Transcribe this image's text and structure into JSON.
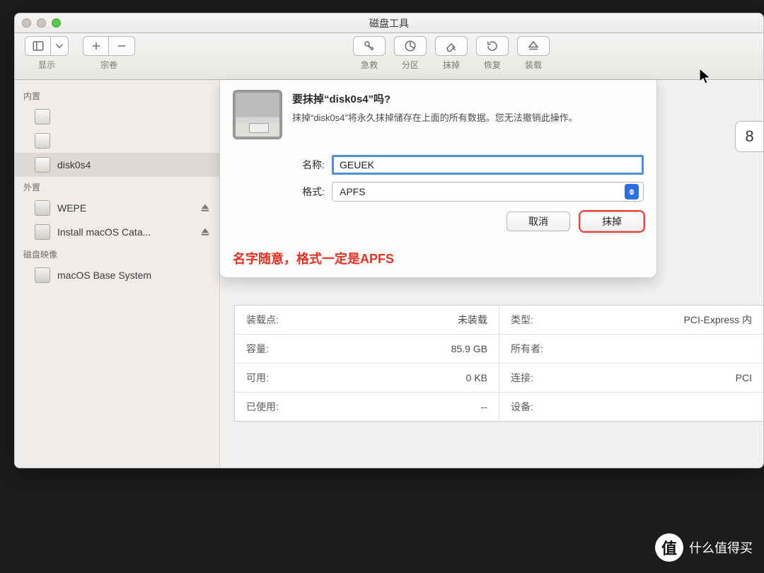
{
  "window": {
    "title": "磁盘工具"
  },
  "toolbar": {
    "view_label": "显示",
    "volume_label": "宗卷",
    "center": [
      {
        "name": "firstaid",
        "label": "急救"
      },
      {
        "name": "partition",
        "label": "分区"
      },
      {
        "name": "erase",
        "label": "抹掉"
      },
      {
        "name": "restore",
        "label": "恢复"
      },
      {
        "name": "mount",
        "label": "装载"
      }
    ]
  },
  "info_button": "8",
  "sidebar": {
    "sections": [
      {
        "header": "内置",
        "items": [
          {
            "name": "internal-disk-0",
            "label": "",
            "icon": "hdd"
          },
          {
            "name": "internal-disk-1",
            "label": "",
            "icon": "hdd"
          },
          {
            "name": "internal-disk0s4",
            "label": "disk0s4",
            "icon": "hdd",
            "selected": true
          }
        ]
      },
      {
        "header": "外置",
        "items": [
          {
            "name": "ext-wepe",
            "label": "WEPE",
            "icon": "ext",
            "eject": true
          },
          {
            "name": "ext-install-catalina",
            "label": "Install macOS Cata...",
            "icon": "ext",
            "eject": true
          }
        ]
      },
      {
        "header": "磁盘映像",
        "items": [
          {
            "name": "img-base-system",
            "label": "macOS Base System",
            "icon": "ext"
          }
        ]
      }
    ]
  },
  "sheet": {
    "title": "要抹掉“disk0s4”吗?",
    "message": "抹掉“disk0s4”将永久抹掉储存在上面的所有数据。您无法撤销此操作。",
    "name_label": "名称:",
    "name_value": "GEUEK",
    "format_label": "格式:",
    "format_value": "APFS",
    "cancel": "取消",
    "erase": "抹掉"
  },
  "annotation": "名字随意，格式一定是APFS",
  "details": {
    "rows": [
      {
        "left_key": "装载点:",
        "left_val": "未装载",
        "right_key": "类型:",
        "right_val": "PCI-Express 内"
      },
      {
        "left_key": "容量:",
        "left_val": "85.9 GB",
        "right_key": "所有者:",
        "right_val": ""
      },
      {
        "left_key": "可用:",
        "left_val": "0 KB",
        "right_key": "连接:",
        "right_val": "PCI"
      },
      {
        "left_key": "已使用:",
        "left_val": "--",
        "right_key": "设备:",
        "right_val": ""
      }
    ]
  },
  "watermark": "什么值得买"
}
